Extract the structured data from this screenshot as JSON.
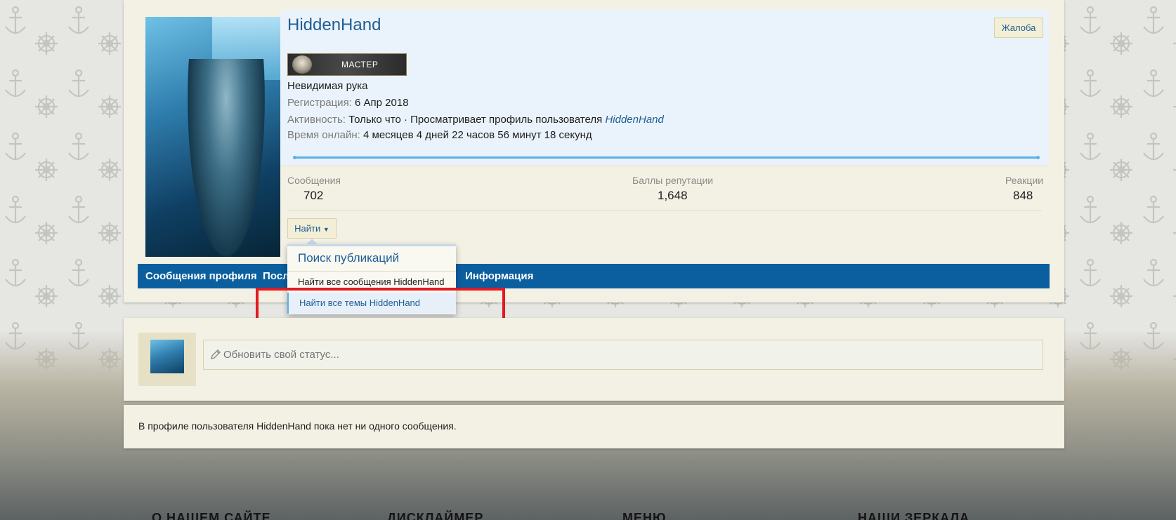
{
  "profile": {
    "username": "HiddenHand",
    "report_label": "Жалоба",
    "rank_label": "МАСТЕР",
    "title": "Невидимая рука",
    "registration_label": "Регистрация:",
    "registration_value": "6 Апр 2018",
    "activity_label": "Активность:",
    "activity_value": "Только что · Просматривает профиль пользователя",
    "activity_link": "HiddenHand",
    "online_label": "Время онлайн:",
    "online_value": "4 месяцев 4 дней 22 часов 56 минут 18 секунд"
  },
  "stats": {
    "messages_label": "Сообщения",
    "messages_value": "702",
    "reputation_label": "Баллы репутации",
    "reputation_value": "1,648",
    "reactions_label": "Реакции",
    "reactions_value": "848"
  },
  "find_button_label": "Найти",
  "tabs": {
    "profile_posts": "Сообщения профиля",
    "latest": "Посл",
    "info": "Информация"
  },
  "find_menu": {
    "title": "Поиск публикаций",
    "items": [
      "Найти все сообщения HiddenHand",
      "Найти все темы HiddenHand"
    ]
  },
  "status": {
    "placeholder": "Обновить свой статус..."
  },
  "empty_message": "В профиле пользователя HiddenHand пока нет ни одного сообщения.",
  "footer": {
    "about": "О НАШЕМ САЙТЕ",
    "disclaimer": "ДИСКЛАЙМЕР",
    "menu": "МЕНЮ",
    "mirrors": "НАШИ ЗЕРКАЛА"
  },
  "colors": {
    "accent": "#1f5e95",
    "tab_bar": "#0b5f9f",
    "card_bg": "#f3f1e4",
    "highlight_box": "#e21a22"
  }
}
